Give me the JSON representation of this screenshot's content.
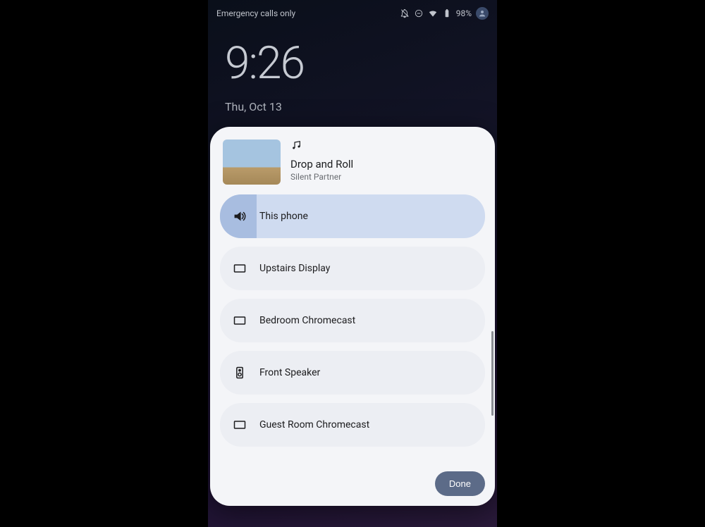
{
  "status": {
    "network_text": "Emergency calls only",
    "battery_text": "98%"
  },
  "lockscreen": {
    "time": "9:26",
    "date": "Thu, Oct 13"
  },
  "media": {
    "track_title": "Drop and Roll",
    "track_artist": "Silent Partner"
  },
  "devices": [
    {
      "label": "This phone",
      "icon": "volume",
      "active": true
    },
    {
      "label": "Upstairs Display",
      "icon": "display",
      "active": false
    },
    {
      "label": "Bedroom Chromecast",
      "icon": "display",
      "active": false
    },
    {
      "label": "Front Speaker",
      "icon": "speaker",
      "active": false
    },
    {
      "label": "Guest Room Chromecast",
      "icon": "display",
      "active": false
    }
  ],
  "footer": {
    "done_label": "Done"
  }
}
